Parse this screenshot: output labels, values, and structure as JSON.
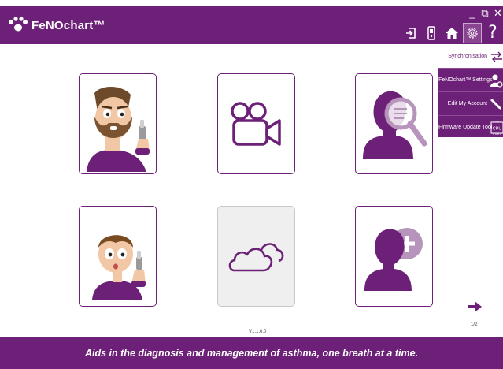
{
  "app": {
    "title": "FeNOchart™"
  },
  "window_controls": {
    "minimize": "_",
    "maximize": "⧉",
    "close": "✕"
  },
  "toolbar": {
    "items": [
      {
        "icon": "logout-icon"
      },
      {
        "icon": "device-icon"
      },
      {
        "icon": "home-icon"
      },
      {
        "icon": "gear-icon",
        "active": true
      },
      {
        "icon": "help-icon",
        "label": "?"
      }
    ]
  },
  "settings_menu": {
    "items": [
      {
        "label": "Synchronisation",
        "icon": "sync-arrows-icon",
        "selected": true
      },
      {
        "label": "FeNOchart™ Settings",
        "icon": "person-gear-icon"
      },
      {
        "label": "Edit My Account",
        "icon": "pencil-icon"
      },
      {
        "label": "Firmware Update Tool",
        "icon": "cpu-chip-icon",
        "chip_text": "CPU"
      }
    ]
  },
  "tiles": [
    {
      "name": "adult-patient-tile",
      "icon": "bearded-man-with-inhaler-icon"
    },
    {
      "name": "video-tile",
      "icon": "video-camera-icon"
    },
    {
      "name": "search-patient-tile",
      "icon": "person-search-icon"
    },
    {
      "name": "child-patient-tile",
      "icon": "boy-with-inhaler-icon"
    },
    {
      "name": "cloud-tile",
      "icon": "cloud-icon",
      "disabled": true
    },
    {
      "name": "add-patient-tile",
      "icon": "add-person-icon"
    }
  ],
  "version": "V1.1.0.0",
  "pagination": {
    "indicator": "1/2"
  },
  "footer": {
    "tagline": "Aids in the diagnosis and management of asthma, one breath at a time."
  },
  "colors": {
    "brand": "#6d2077",
    "disabled_tile": "#efefef"
  }
}
